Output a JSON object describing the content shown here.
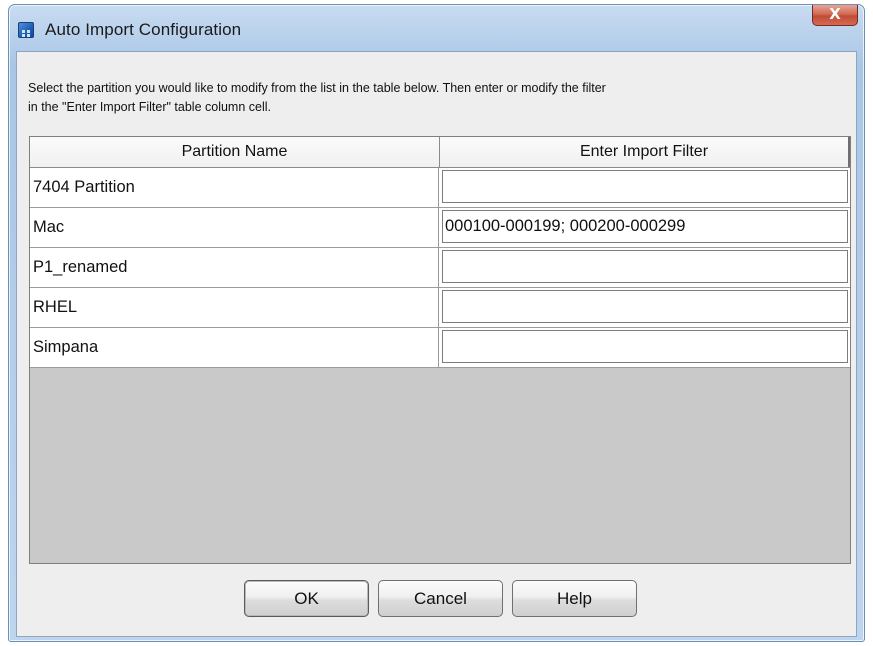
{
  "window": {
    "title": "Auto Import Configuration",
    "close_glyph": "X"
  },
  "instructions": {
    "line1": "Select the partition you would like to modify from the list in the table below. Then enter or modify the filter",
    "line2": "in the \"Enter Import Filter\" table column cell."
  },
  "table": {
    "columns": [
      "Partition Name",
      "Enter Import Filter"
    ],
    "rows": [
      {
        "name": "7404 Partition",
        "filter": ""
      },
      {
        "name": "Mac",
        "filter": "000100-000199; 000200-000299"
      },
      {
        "name": "P1_renamed",
        "filter": ""
      },
      {
        "name": "RHEL",
        "filter": ""
      },
      {
        "name": "Simpana",
        "filter": ""
      }
    ]
  },
  "buttons": {
    "ok": "OK",
    "cancel": "Cancel",
    "help": "Help"
  },
  "icons": {
    "app": "app-window-icon",
    "close": "close-icon"
  }
}
